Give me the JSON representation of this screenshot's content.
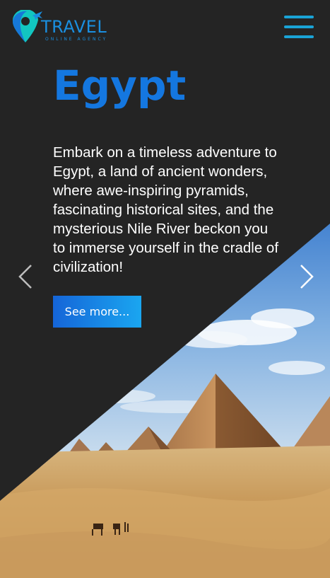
{
  "header": {
    "logo_text": "TRAVEL",
    "logo_subtext": "ONLINE AGENCY",
    "logo_icon": "location-pin-plane-icon",
    "menu_icon": "hamburger-menu-icon"
  },
  "slide": {
    "title": "Egypt",
    "description": "Embark on a timeless adventure to Egypt, a land of ancient wonders, where awe-inspiring pyramids, fascinating historical sites, and the mysterious Nile River beckon you to immerse yourself in the cradle of civilization!",
    "button_label": "See more...",
    "image": "pyramids-desert-photo"
  },
  "carousel": {
    "prev_icon": "chevron-left-icon",
    "next_icon": "chevron-right-icon"
  },
  "colors": {
    "accent": "#1477e0",
    "background": "#242424",
    "menu": "#1aa3d6"
  }
}
